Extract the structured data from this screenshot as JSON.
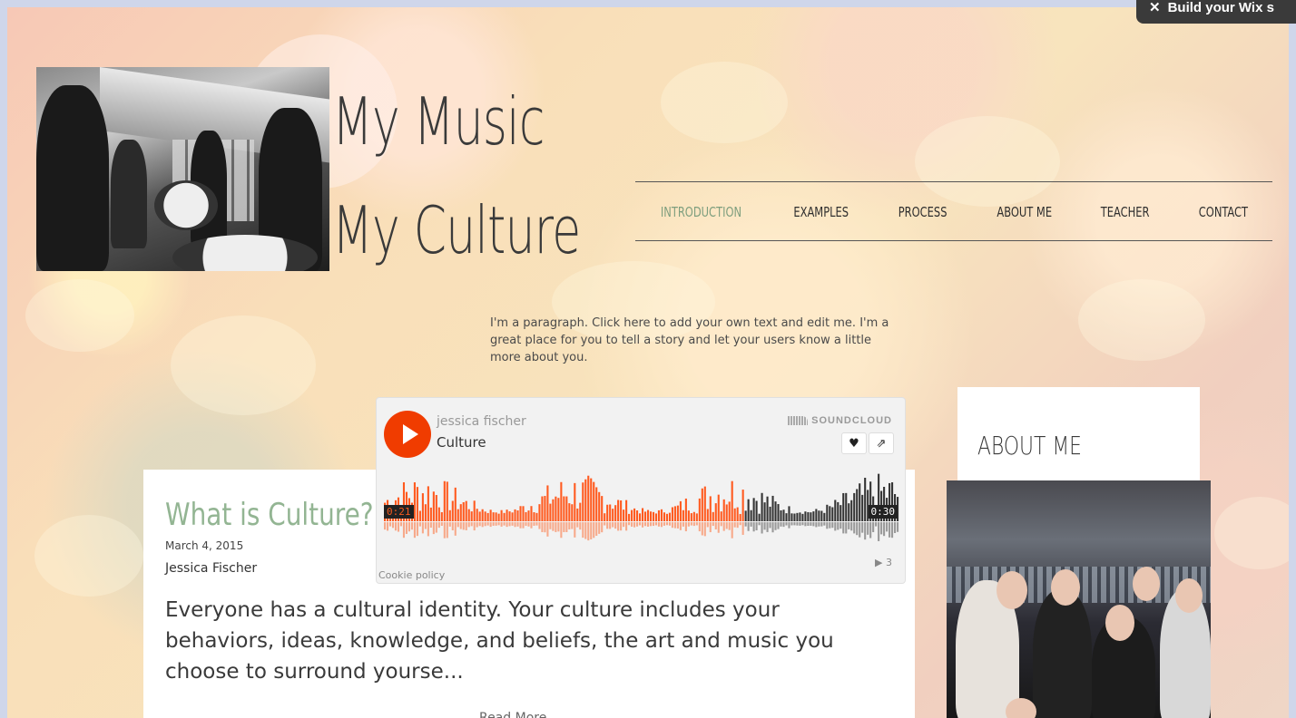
{
  "banner": {
    "label": "Build your Wix s"
  },
  "site": {
    "title_line1": "My Music",
    "title_line2": "My Culture"
  },
  "nav": {
    "items": [
      {
        "label": "INTRODUCTION",
        "active": true
      },
      {
        "label": "EXAMPLES",
        "active": false
      },
      {
        "label": "PROCESS",
        "active": false
      },
      {
        "label": "ABOUT ME",
        "active": false
      },
      {
        "label": "TEACHER",
        "active": false
      },
      {
        "label": "CONTACT",
        "active": false
      }
    ],
    "active_color": "#7e9e7e"
  },
  "intro": {
    "paragraph": "I'm a paragraph. Click here to add your own text and edit me. I'm a great place for you to tell a story and let your users know a little more about you."
  },
  "soundcloud": {
    "artist": "jessica fischer",
    "track": "Culture",
    "brand": "SOUNDCLOUD",
    "elapsed": "0:21",
    "duration": "0:30",
    "progress": 0.7,
    "cookie_policy": "Cookie policy",
    "play_count": "▶ 3",
    "accent_color": "#f03c00"
  },
  "post": {
    "title": "What is Culture?",
    "date": "March 4, 2015",
    "author": "Jessica Fischer",
    "excerpt": "Everyone has a cultural identity. Your culture includes your behaviors, ideas, knowledge, and beliefs, the art and music you choose to surround yourse...",
    "read_more": "Read More",
    "title_color": "#93b593"
  },
  "sidebar": {
    "about_heading": "ABOUT ME"
  }
}
